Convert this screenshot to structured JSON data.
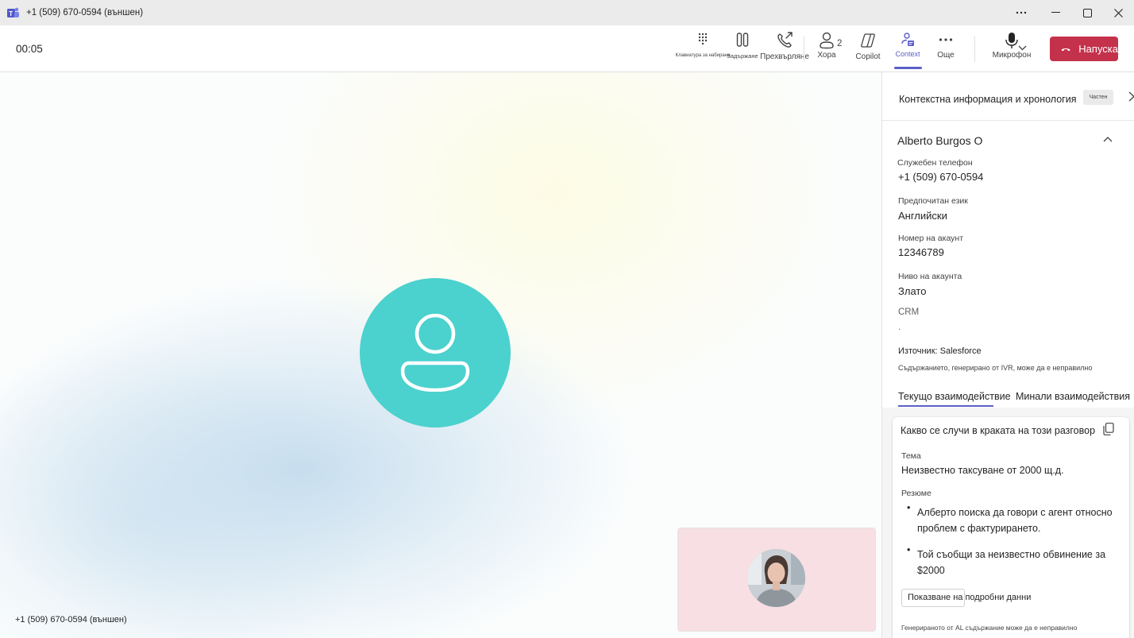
{
  "window": {
    "title": "+1 (509) 670-0594 (външен)",
    "controls": [
      "more-icon",
      "minimize-icon",
      "maximize-icon",
      "close-icon"
    ]
  },
  "toolbar": {
    "timer": "00:05",
    "dialpad_label": "Клавиатура за набиране",
    "hold_label": "Задържане",
    "transfer_label": "Прехвърляне",
    "people_label": "Хора",
    "people_count": "2",
    "copilot_label": "Copilot",
    "context_label": "Context",
    "more_label": "Още",
    "mic_label": "Микрофон",
    "hangup_label": "Напуска",
    "accent_color": "#5b5fc7",
    "hangup_color": "#c4314b"
  },
  "stage": {
    "caller_label": "+1 (509) 670-0594 (външен)",
    "avatar_color": "#4bd1ce"
  },
  "panel": {
    "title": "Контекстна информация и хронология",
    "badge": "Частен",
    "contact_name": "Alberto Burgos O",
    "fields": [
      {
        "label": "Служебен телефон",
        "value": "+1 (509) 670-0594"
      },
      {
        "label": "Предпочитан език",
        "value": "Английски"
      },
      {
        "label": "Номер на акаунт",
        "value": "12346789"
      },
      {
        "label": "Ниво на акаунта",
        "value": "Злато"
      }
    ],
    "crm_label": "CRM",
    "crm_value": ".",
    "source": "Източник: Salesforce",
    "ivr_note": "Съдържанието, генерирано от IVR, може да е неправилно",
    "tabs": [
      "Текущо взаимодействие",
      "Минали взаимодействия"
    ],
    "card": {
      "heading": "Какво се случи в краката на този разговор",
      "topic_label": "Тема",
      "topic_value": "Неизвестно таксуване от 2000 щ.д.",
      "summary_label": "Резюме",
      "bullets": [
        "Алберто поиска да говори с агент относно проблем с фактурирането.",
        "Той съобщи за неизвестно обвинение за $2000"
      ],
      "details_button": "Показване на подробни данни",
      "ai_note": "Генерираното от AL съдържание може да е неправилно"
    }
  }
}
